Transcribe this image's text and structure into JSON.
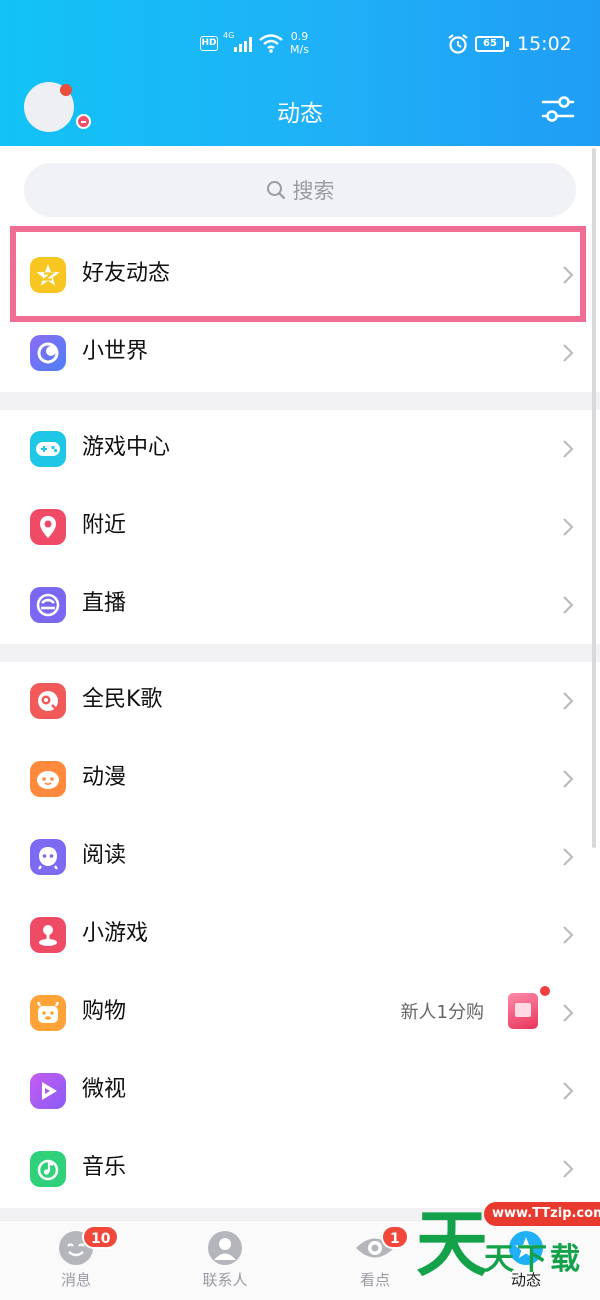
{
  "status_bar": {
    "hd": "HD",
    "network": "4G",
    "speed_value": "0.9",
    "speed_unit": "M/s",
    "battery": "65",
    "time": "15:02"
  },
  "header": {
    "title": "动态",
    "settings_icon": "sliders-icon",
    "avatar_status": "offline"
  },
  "search": {
    "placeholder": "搜索"
  },
  "highlight_color": "#f06e93",
  "groups": [
    {
      "items": [
        {
          "label": "好友动态",
          "icon": "qzone-star-icon",
          "color": "#f7c620"
        },
        {
          "label": "小世界",
          "icon": "planet-icon",
          "color": "#6b6cf0"
        }
      ]
    },
    {
      "items": [
        {
          "label": "游戏中心",
          "icon": "gamepad-icon",
          "color": "#1fc7e6"
        },
        {
          "label": "附近",
          "icon": "location-pin-icon",
          "color": "#f04b66"
        },
        {
          "label": "直播",
          "icon": "live-tv-icon",
          "color": "#7a67f2"
        }
      ]
    },
    {
      "items": [
        {
          "label": "全民K歌",
          "icon": "karaoke-icon",
          "color": "#f25a5a"
        },
        {
          "label": "动漫",
          "icon": "anime-face-icon",
          "color": "#ff8a3d"
        },
        {
          "label": "阅读",
          "icon": "reading-icon",
          "color": "#7a6bf2"
        },
        {
          "label": "小游戏",
          "icon": "joystick-icon",
          "color": "#f04b66"
        },
        {
          "label": "购物",
          "icon": "shopping-icon",
          "color": "#ffa238",
          "extra": "新人1分购"
        },
        {
          "label": "微视",
          "icon": "video-play-icon",
          "color": "#b45cf2"
        },
        {
          "label": "音乐",
          "icon": "music-icon",
          "color": "#2fd27a"
        }
      ]
    }
  ],
  "tabbar": [
    {
      "label": "消息",
      "icon": "message-icon",
      "badge": "10"
    },
    {
      "label": "联系人",
      "icon": "contacts-icon"
    },
    {
      "label": "看点",
      "icon": "eye-icon",
      "badge": "1"
    },
    {
      "label": "动态",
      "icon": "star-tab-icon",
      "active": true
    }
  ],
  "watermark": {
    "url": "www.TTzip.com",
    "big": "天",
    "small": "天下载"
  }
}
